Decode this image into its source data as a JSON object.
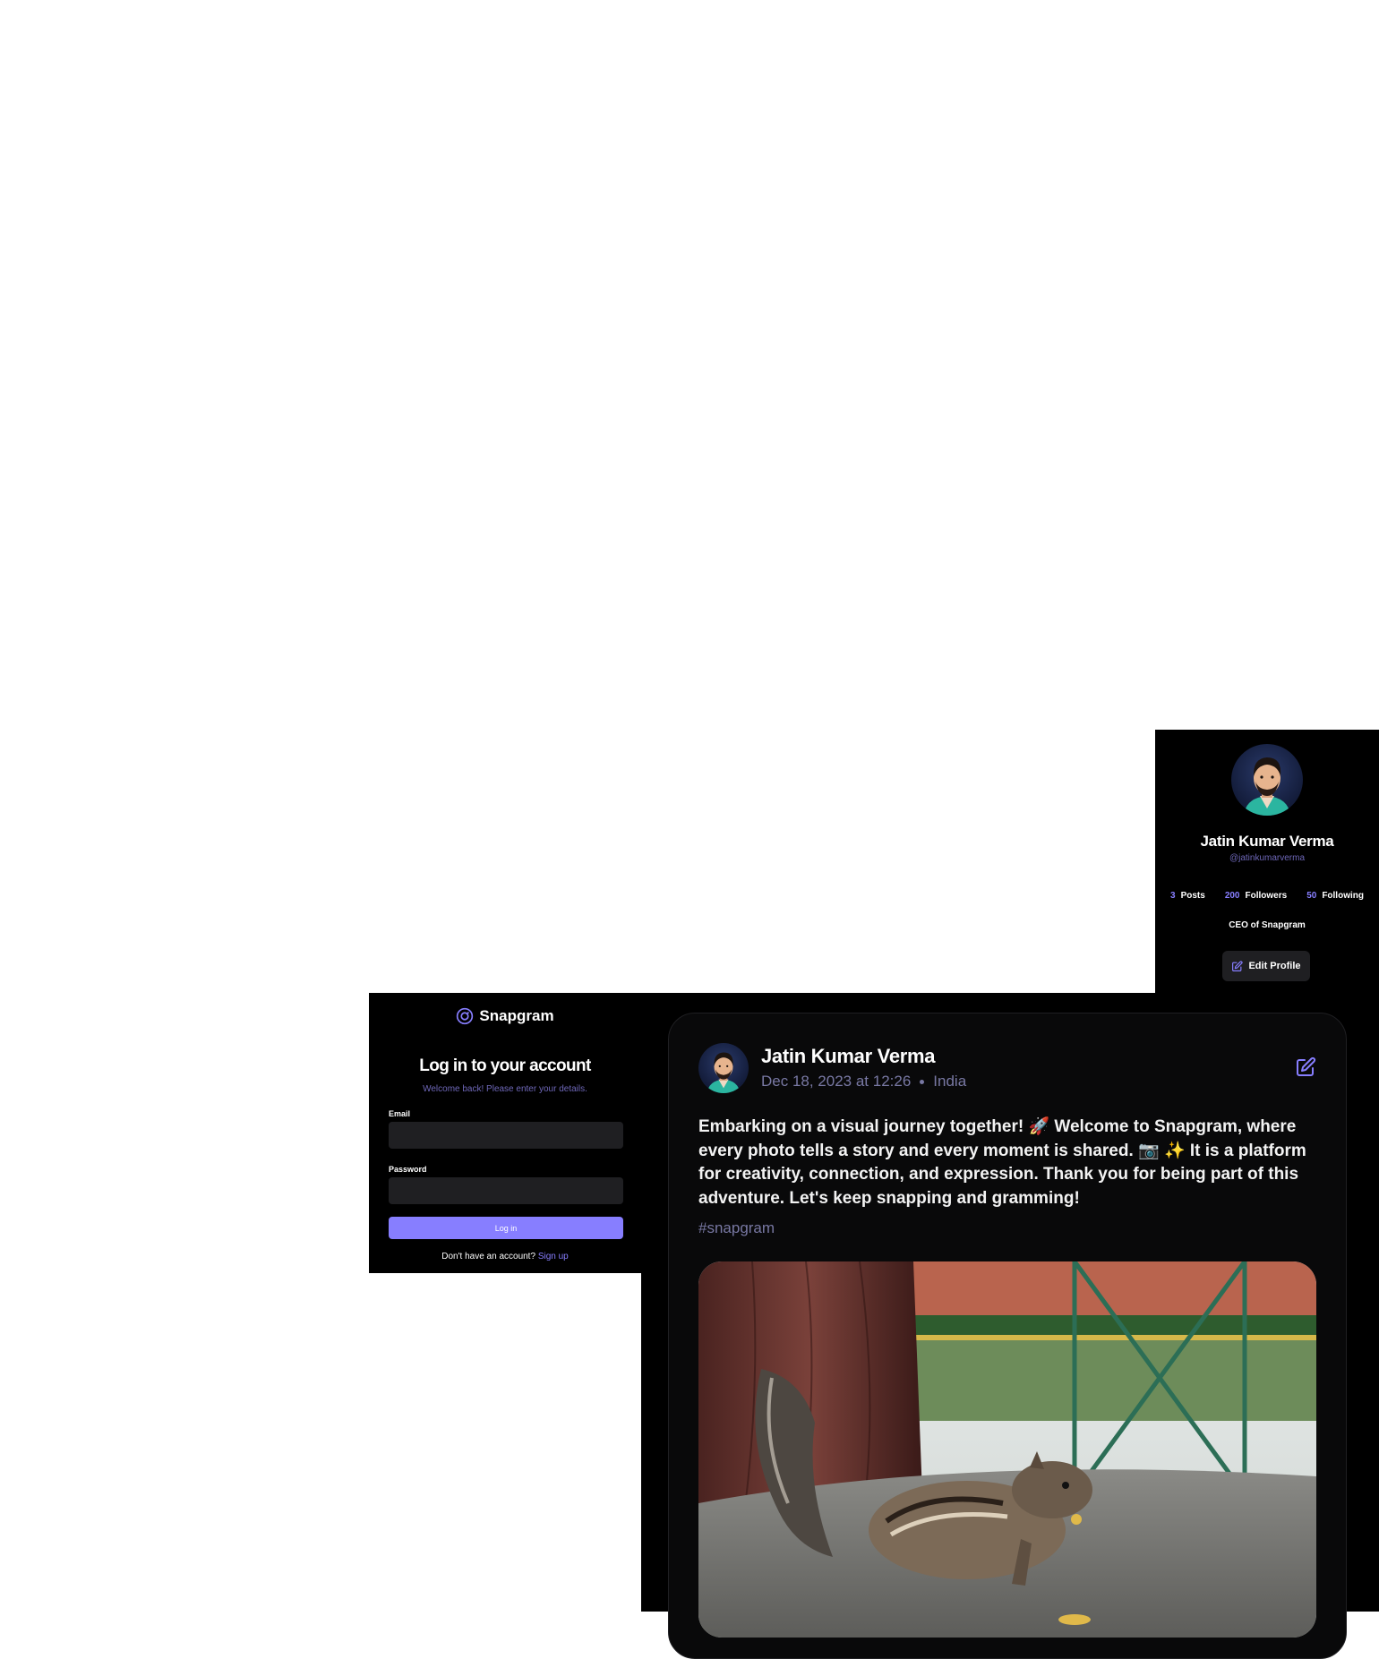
{
  "profile": {
    "name": "Jatin Kumar Verma",
    "handle": "@jatinkumarverma",
    "stats": [
      {
        "value": "3",
        "label": "Posts"
      },
      {
        "value": "200",
        "label": "Followers"
      },
      {
        "value": "50",
        "label": "Following"
      }
    ],
    "bio": "CEO of Snapgram",
    "edit_label": "Edit Profile"
  },
  "login": {
    "brand": "Snapgram",
    "title": "Log in to your account",
    "subtitle": "Welcome back! Please enter your details.",
    "email_label": "Email",
    "email_value": "",
    "password_label": "Password",
    "password_value": "",
    "button_label": "Log in",
    "signup_prompt": "Don't have an account?",
    "signup_link": "Sign up"
  },
  "post": {
    "author": "Jatin Kumar Verma",
    "date": "Dec 18, 2023 at 12:26",
    "location": "India",
    "caption": "Embarking on a visual journey together! 🚀 Welcome to Snapgram, where every photo tells a story and every moment is shared. 📷 ✨ It is a platform for creativity, connection, and expression. Thank you for being part of this adventure. Let's keep snapping and gramming!",
    "tag": "#snapgram"
  },
  "colors": {
    "accent": "#877eff",
    "panel": "#000000",
    "input": "#1f1f22",
    "muted": "#7878a3"
  },
  "icons": [
    "snapgram-logo-icon",
    "edit-icon",
    "avatar-illustration"
  ]
}
